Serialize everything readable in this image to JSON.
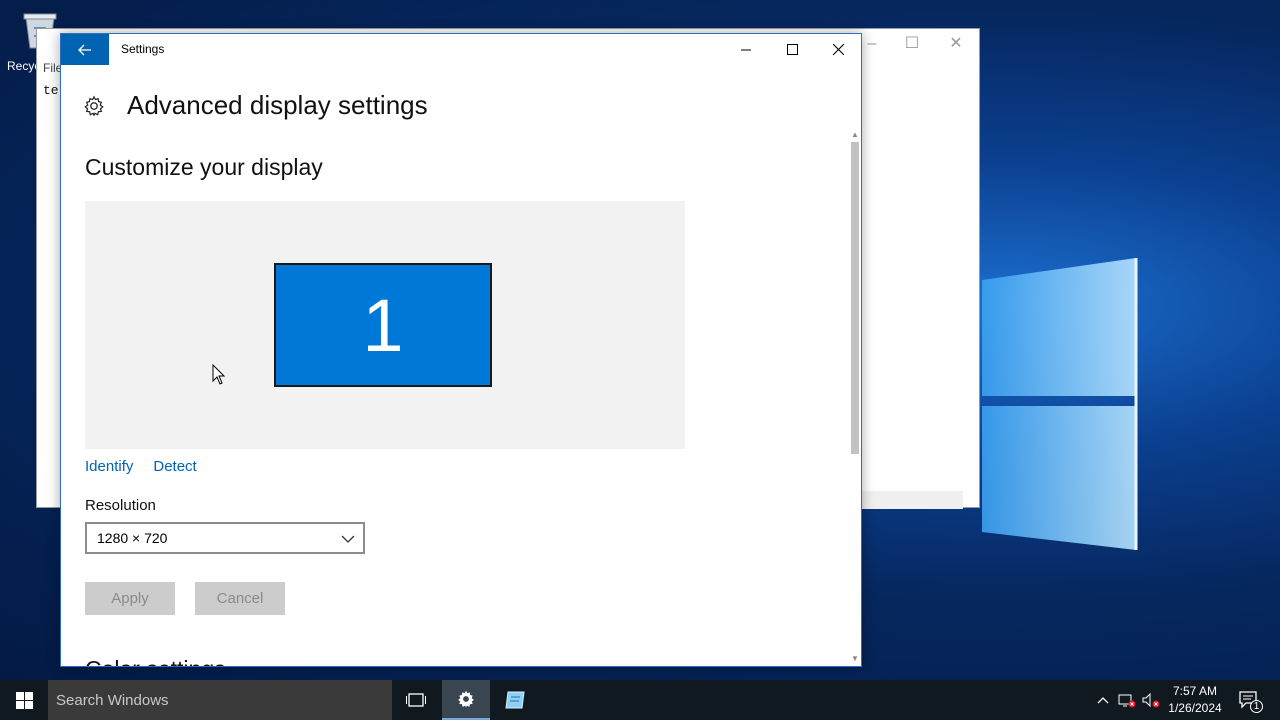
{
  "desktop": {
    "recycle_bin_label": "Recyc"
  },
  "notepad": {
    "menu_text": "File",
    "content_text": "te"
  },
  "settings": {
    "window_title": "Settings",
    "page_title": "Advanced display settings",
    "section_title": "Customize your display",
    "monitor_number": "1",
    "identify_link": "Identify",
    "detect_link": "Detect",
    "resolution_label": "Resolution",
    "resolution_value": "1280 × 720",
    "apply_label": "Apply",
    "cancel_label": "Cancel",
    "next_section_partial": "Color settings"
  },
  "taskbar": {
    "search_placeholder": "Search Windows",
    "time": "7:57 AM",
    "date": "1/26/2024",
    "notification_count": "1"
  },
  "colors": {
    "accent": "#0078d7",
    "back_button": "#0063b1",
    "link": "#0063b1",
    "taskbar": "#101820"
  }
}
